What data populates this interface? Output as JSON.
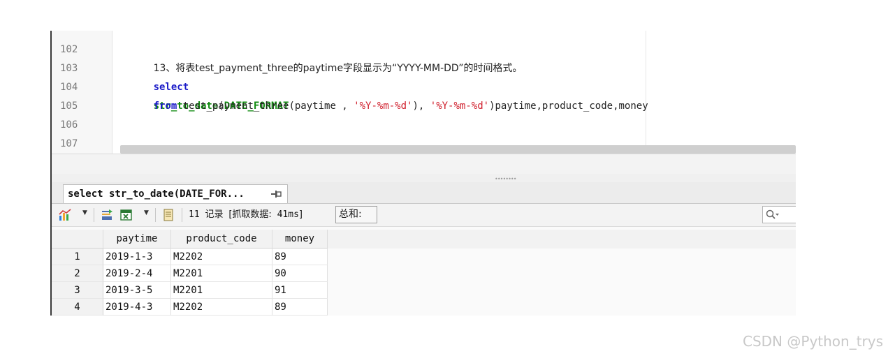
{
  "editor": {
    "line_numbers": [
      "102",
      "103",
      "104",
      "105",
      "106",
      "107"
    ],
    "line102_comment": "13、将表test_payment_three的paytime字段显示为“YYYY-MM-DD”的时间格式。",
    "line103": {
      "kw_select": "select",
      "fn_str_to_date": "str_to_date",
      "p1": "(",
      "fn_date_format": "DATE_FORMAT",
      "p2": "(paytime , ",
      "s1": "'%Y-%m-%d'",
      "p3": "), ",
      "s2": "'%Y-%m-%d'",
      "p4": ")paytime,product_code,money"
    },
    "line104": {
      "kw_from": "from",
      "rest": " test_payment_three"
    }
  },
  "result_tab": {
    "label": "select str_to_date(DATE_FOR..."
  },
  "toolbar": {
    "record_count": "11",
    "record_word": "记录",
    "fetch_open": "[抓取数据:",
    "fetch_time": "41ms",
    "fetch_close": "]",
    "sum_label": "总和:"
  },
  "grid": {
    "columns": [
      "paytime",
      "product_code",
      "money"
    ],
    "rows": [
      {
        "num": "1",
        "paytime": "2019-1-3",
        "product_code": "M2202",
        "money": "89"
      },
      {
        "num": "2",
        "paytime": "2019-2-4",
        "product_code": "M2201",
        "money": "90"
      },
      {
        "num": "3",
        "paytime": "2019-3-5",
        "product_code": "M2201",
        "money": "91"
      },
      {
        "num": "4",
        "paytime": "2019-4-3",
        "product_code": "M2202",
        "money": "89"
      }
    ]
  },
  "watermark": "CSDN @Python_trys",
  "colors": {
    "keyword": "#1c1cc8",
    "function": "#0f8a0f",
    "string": "#d01f2c"
  }
}
